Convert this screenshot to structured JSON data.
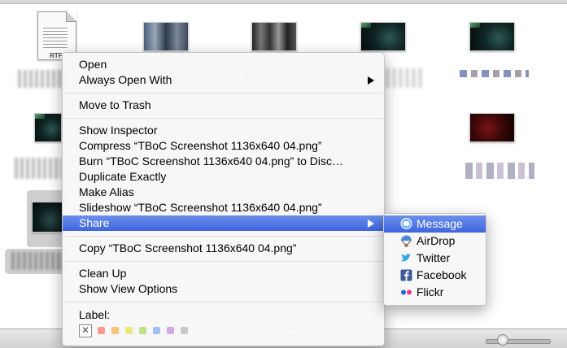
{
  "desktop": {
    "doc_icon_type": "RTF",
    "icons": {
      "message": "message-bubble-icon",
      "airdrop": "airdrop-parachute-icon",
      "twitter": "twitter-bird-icon",
      "facebook": "facebook-f-icon",
      "flickr": "flickr-dots-icon",
      "submenu": "chevron-right-icon",
      "no_label": "x-mark-icon"
    }
  },
  "context_menu": {
    "open": "Open",
    "always_open_with": "Always Open With",
    "move_to_trash": "Move to Trash",
    "show_inspector": "Show Inspector",
    "compress": "Compress “TBoC Screenshot 1136x640 04.png”",
    "burn": "Burn “TBoC Screenshot 1136x640 04.png” to Disc…",
    "duplicate_exactly": "Duplicate Exactly",
    "make_alias": "Make Alias",
    "slideshow": "Slideshow “TBoC Screenshot 1136x640 04.png”",
    "share": "Share",
    "copy": "Copy “TBoC Screenshot 1136x640 04.png”",
    "clean_up": "Clean Up",
    "show_view_options": "Show View Options",
    "label_title": "Label:",
    "label_colors": [
      "#f59a8f",
      "#f9c27c",
      "#ece77a",
      "#bde28a",
      "#9ec3f2",
      "#d2a7e6",
      "#c8c8c8"
    ],
    "highlight_color": "#3f65e0"
  },
  "share_submenu": {
    "message": "Message",
    "airdrop": "AirDrop",
    "twitter": "Twitter",
    "facebook": "Facebook",
    "flickr": "Flickr"
  }
}
